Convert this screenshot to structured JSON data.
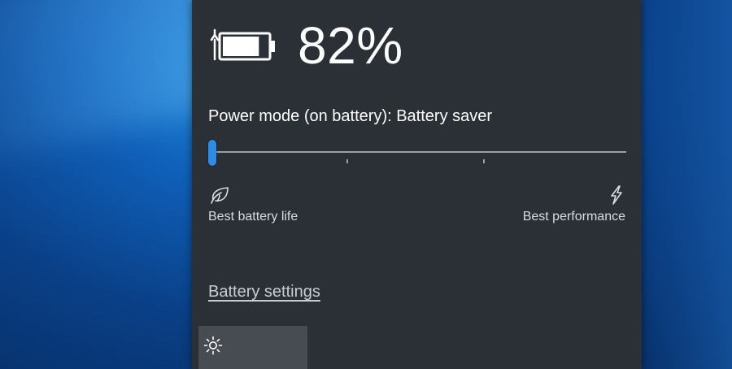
{
  "battery": {
    "percent_text": "82%",
    "level": 0.82
  },
  "power_mode": {
    "label": "Power mode (on battery): Battery saver",
    "slider_position": 0,
    "tick_count": 4,
    "left_label": "Best battery life",
    "right_label": "Best performance",
    "left_icon": "leaf-icon",
    "right_icon": "lightning-icon"
  },
  "links": {
    "battery_settings": "Battery settings"
  },
  "quick_actions": {
    "brightness_icon": "brightness-icon"
  },
  "colors": {
    "flyout_bg": "#2b2f36",
    "accent": "#2d8ce6",
    "tile_bg": "#474b52"
  }
}
